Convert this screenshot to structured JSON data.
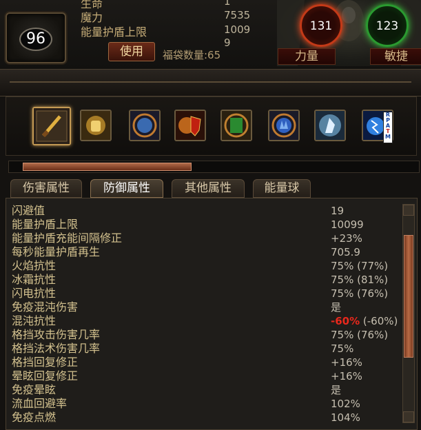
{
  "character": {
    "level": "96",
    "stats": [
      {
        "label": "生命",
        "value": "1"
      },
      {
        "label": "魔力",
        "value": "7535"
      },
      {
        "label": "能量护盾上限",
        "value": "1009"
      },
      {
        "label": "",
        "value": "9"
      }
    ],
    "use_button": "使用",
    "bag_count_label": "福袋数量:65"
  },
  "attributes": {
    "strength": {
      "value": "131",
      "label": "力量"
    },
    "dexterity": {
      "value": "123",
      "label": "敏捷"
    }
  },
  "skills": [
    {
      "icon": "sword-skill-icon",
      "selected": true
    },
    {
      "icon": "golden-fist-skill-icon",
      "selected": false
    },
    {
      "icon": "blue-aura-skill-icon",
      "selected": false
    },
    {
      "icon": "fire-shield-skill-icon",
      "selected": false
    },
    {
      "icon": "green-door-skill-icon",
      "selected": false
    },
    {
      "icon": "blue-hand-skill-icon",
      "selected": false
    },
    {
      "icon": "ghost-runner-skill-icon",
      "selected": false
    },
    {
      "icon": "lightning-orb-skill-icon",
      "selected": false
    }
  ],
  "skill_badge_letters": [
    "R",
    "P",
    "A",
    "T",
    "M"
  ],
  "tabs": [
    {
      "label": "伤害属性",
      "active": false
    },
    {
      "label": "防御属性",
      "active": true
    },
    {
      "label": "其他属性",
      "active": false
    },
    {
      "label": "能量球",
      "active": false
    }
  ],
  "defense_stats": [
    {
      "name": "闪避值",
      "value": "19"
    },
    {
      "name": "能量护盾上限",
      "value": "10099"
    },
    {
      "name": "能量护盾充能间隔修正",
      "value": "+23%"
    },
    {
      "name": "每秒能量护盾再生",
      "value": "705.9"
    },
    {
      "name": "火焰抗性",
      "value": "75% (77%)"
    },
    {
      "name": "冰霜抗性",
      "value": "75% (81%)"
    },
    {
      "name": "闪电抗性",
      "value": "75% (76%)"
    },
    {
      "name": "免疫混沌伤害",
      "value": "是"
    },
    {
      "name": "混沌抗性",
      "value_neg": "-60%",
      "value_rest": " (-60%)"
    },
    {
      "name": "格挡攻击伤害几率",
      "value": "75% (76%)"
    },
    {
      "name": "格挡法术伤害几率",
      "value": "75%"
    },
    {
      "name": "格挡回复修正",
      "value": "+16%"
    },
    {
      "name": "晕眩回复修正",
      "value": "+16%"
    },
    {
      "name": "免疫晕眩",
      "value": "是"
    },
    {
      "name": "流血回避率",
      "value": "102%"
    },
    {
      "name": "免疫点燃",
      "value": "104%"
    }
  ],
  "colors": {
    "negative_value": "#e8281c",
    "label_gold": "#d4c28f",
    "value_gray": "#c6bfb0"
  }
}
